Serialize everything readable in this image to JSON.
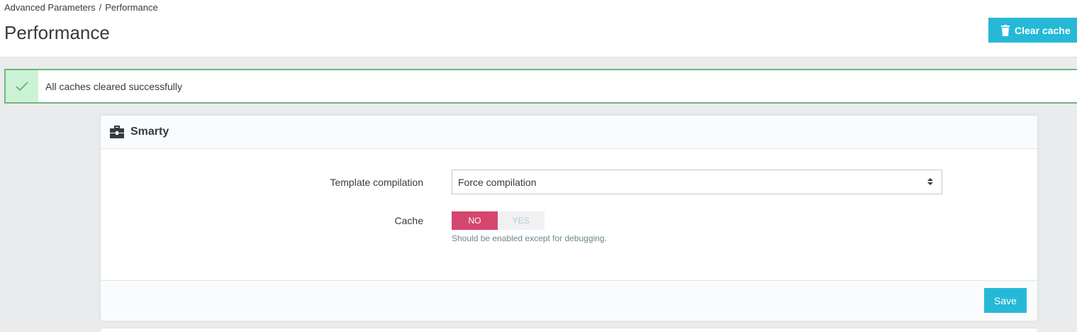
{
  "breadcrumb": {
    "parent": "Advanced Parameters",
    "separator": "/",
    "current": "Performance"
  },
  "page_title": "Performance",
  "toolbar": {
    "clear_cache_label": "Clear cache",
    "clear_cache_icon": "trash-icon"
  },
  "alert": {
    "type": "success",
    "message": "All caches cleared successfully",
    "icon": "check-icon"
  },
  "smarty": {
    "title": "Smarty",
    "icon": "toolbox-icon",
    "template_compilation": {
      "label": "Template compilation",
      "value": "Force compilation"
    },
    "cache": {
      "label": "Cache",
      "no_label": "NO",
      "yes_label": "YES",
      "selected": "NO",
      "help": "Should be enabled except for debugging."
    },
    "save_label": "Save"
  },
  "colors": {
    "accent": "#25b9d7",
    "success": "#70b580",
    "danger": "#d5466e"
  }
}
